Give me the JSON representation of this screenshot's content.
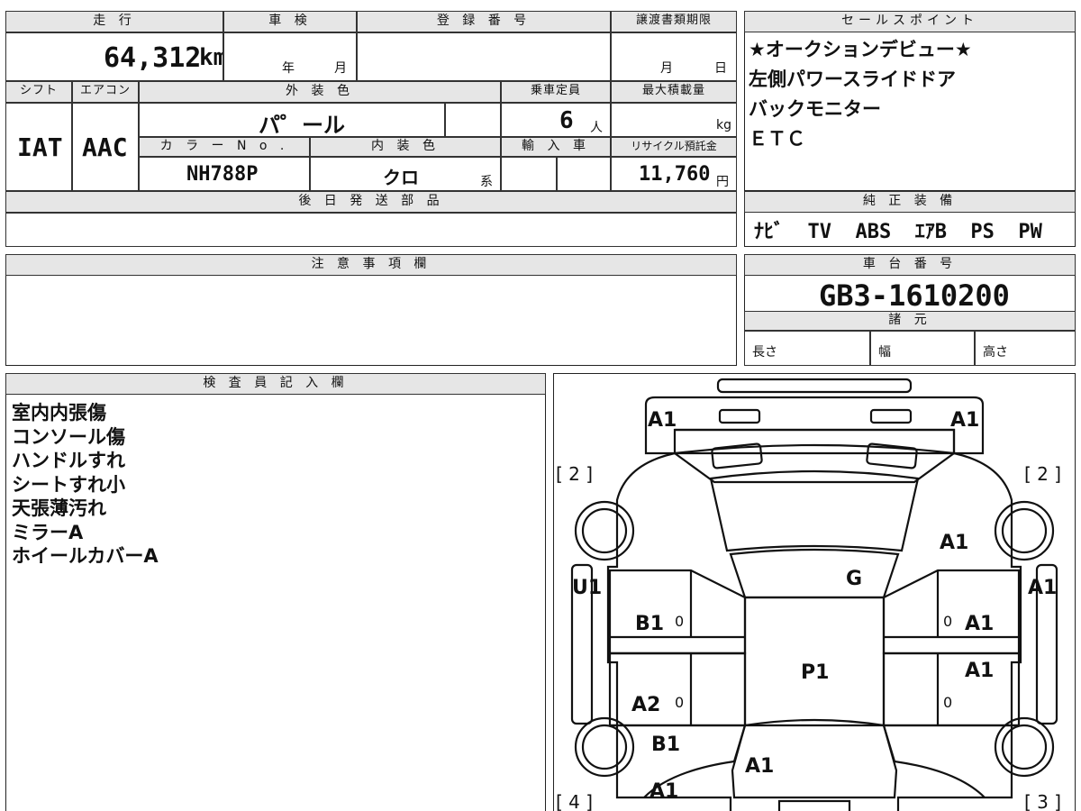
{
  "top_section": {
    "mileage": {
      "label": "走 行",
      "value": "64,312",
      "unit": "km"
    },
    "inspection": {
      "label": "車 検",
      "year_label": "年",
      "month_label": "月"
    },
    "registration": {
      "label": "登 録 番 号"
    },
    "transfer": {
      "label": "譲渡書類期限",
      "month_label": "月",
      "day_label": "日"
    },
    "shift": {
      "label": "シフト",
      "value": "IAT"
    },
    "aircon": {
      "label": "エアコン",
      "value": "AAC"
    },
    "exterior_color": {
      "label": "外 装 色",
      "value": "パ゜ール"
    },
    "capacity": {
      "label": "乗車定員",
      "value": "6",
      "unit": "人"
    },
    "max_load": {
      "label": "最大積載量",
      "unit": "kg"
    },
    "color_no": {
      "label": "カ ラ ー N o .",
      "value": "NH788P"
    },
    "interior_color": {
      "label": "内 装 色",
      "value": "クロ",
      "unit": "系"
    },
    "import": {
      "label": "輸 入 車"
    },
    "recycle": {
      "label": "リサイクル預託金",
      "value": "11,760",
      "unit": "円"
    },
    "later_parts": {
      "label": "後 日 発 送 部 品"
    }
  },
  "sales_points": {
    "label": "セールスポイント",
    "items": [
      "★オークションデビュー★",
      "左側パワースライドドア",
      "バックモニター",
      "ＥＴＣ"
    ]
  },
  "genuine_equipment": {
    "label": "純 正 装 備",
    "value": "ﾅﾋﾞ  TV  ABS  ｴｱB  PS  PW"
  },
  "caution": {
    "label": "注 意 事 項 欄"
  },
  "chassis": {
    "label": "車 台 番 号",
    "value": "GB3-1610200"
  },
  "specs": {
    "label": "諸 元",
    "length_label": "長さ",
    "width_label": "幅",
    "height_label": "高さ"
  },
  "inspector": {
    "label": "検 査 員 記 入 欄",
    "notes": [
      "室内内張傷",
      "コンソール傷",
      "ハンドルすれ",
      "シートすれ小",
      "天張薄汚れ",
      "ミラーA",
      "ホイールカバーA"
    ]
  },
  "diagram": {
    "marks": {
      "front_left": "A1",
      "front_right": "A1",
      "bracket_front_left": "[ 2 ]",
      "bracket_front_right": "[ 2 ]",
      "fender_right": "A1",
      "windshield": "G",
      "side_left": "U1",
      "side_right": "A1",
      "door_left_front": "B1",
      "door_right_front": "A1",
      "door_right_rear": "A1",
      "roof": "P1",
      "door_left_rear": "A2",
      "quarter_left": "B1",
      "rear_glass": "A1",
      "rear_left": "A1",
      "bracket_rear_left": "[ 4 ]",
      "bracket_rear_right": "[ 3 ]",
      "zero_left_front": "0",
      "zero_right_front": "0",
      "zero_left_rear": "0",
      "zero_right_rear": "0"
    }
  }
}
